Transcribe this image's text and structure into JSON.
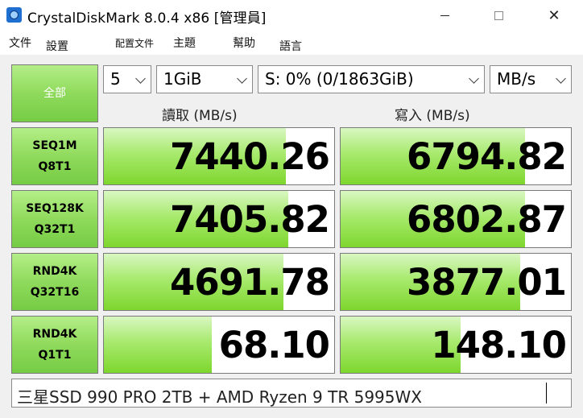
{
  "window": {
    "title": "CrystalDiskMark 8.0.4 x86 [管理員]",
    "controls": {
      "minimize": "",
      "maximize": "",
      "close": "✕"
    }
  },
  "menu": [
    "文件",
    "設置",
    "配置文件",
    "主題",
    "幫助",
    "語言"
  ],
  "toolbar": {
    "all_button": "全部",
    "count": "5",
    "size": "1GiB",
    "drive": "S: 0% (0/1863GiB)",
    "unit": "MB/s"
  },
  "columns": {
    "read": "讀取 (MB/s)",
    "write": "寫入 (MB/s)"
  },
  "tests": [
    {
      "line1": "SEQ1M",
      "line2": "Q8T1",
      "read": "7440.26",
      "write": "6794.82",
      "read_fill": 0.79,
      "write_fill": 0.8
    },
    {
      "line1": "SEQ128K",
      "line2": "Q32T1",
      "read": "7405.82",
      "write": "6802.87",
      "read_fill": 0.8,
      "write_fill": 0.8
    },
    {
      "line1": "RND4K",
      "line2": "Q32T16",
      "read": "4691.78",
      "write": "3877.01",
      "read_fill": 0.78,
      "write_fill": 0.78
    },
    {
      "line1": "RND4K",
      "line2": "Q1T1",
      "read": "68.10",
      "write": "148.10",
      "read_fill": 0.47,
      "write_fill": 0.52
    }
  ],
  "comment": "三星SSD 990 PRO 2TB + AMD Ryzen 9 TR 5995WX",
  "colors": {
    "button_green": "#8fda5c",
    "bar_green": "#7ed62e",
    "background": "#f0f0f0"
  }
}
